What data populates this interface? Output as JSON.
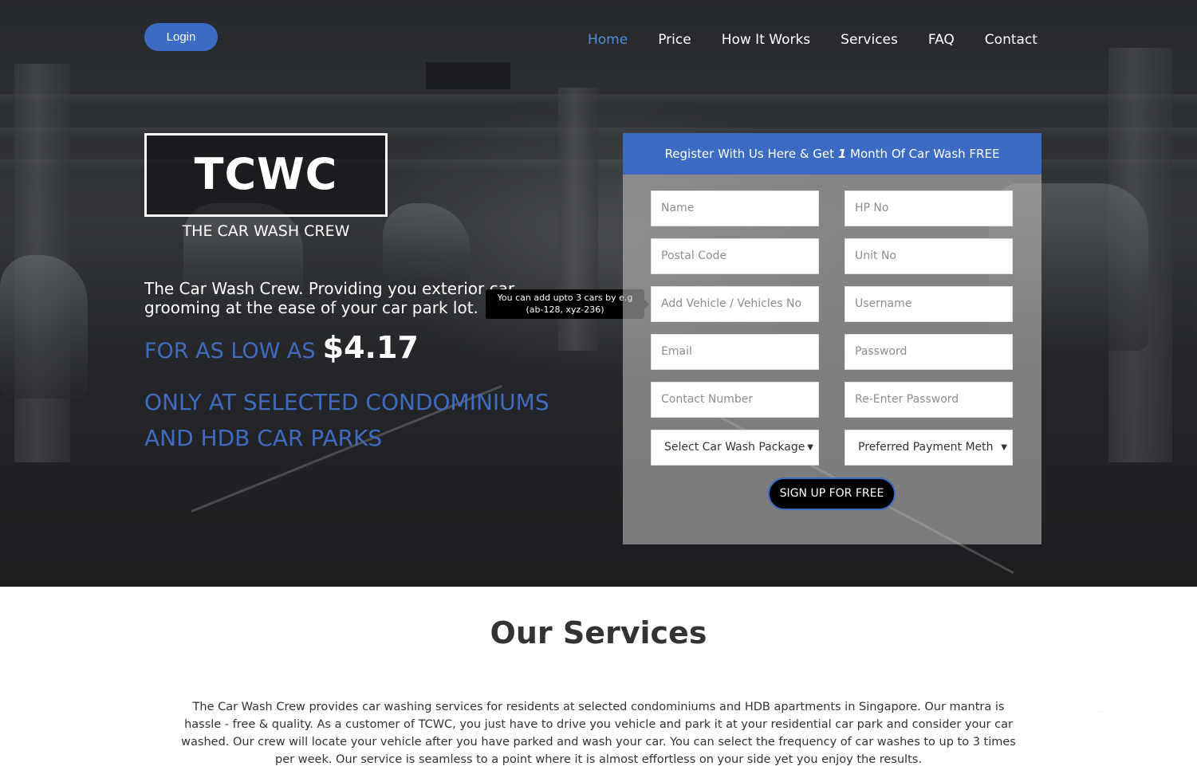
{
  "nav": {
    "login_label": "Login",
    "items": [
      "Home",
      "Price",
      "How It Works",
      "Services",
      "FAQ",
      "Contact"
    ],
    "active_item": "Home"
  },
  "hero": {
    "logo_text": "TCWC",
    "logo_subtitle": "THE CAR WASH CREW",
    "tagline": "The Car Wash Crew. Providing you exterior car grooming at the ease of your car park lot.",
    "price_prefix": "FOR AS LOW AS",
    "price_value": "$4.17",
    "condo_line_1": "ONLY AT SELECTED CONDOMINIUMS",
    "condo_line_2": "AND HDB CAR PARKS"
  },
  "tooltip": {
    "line1": "You can add upto 3 cars by e.g",
    "line2": "(ab-128, xyz-236)"
  },
  "form": {
    "header_before": "Register With Us Here & Get",
    "header_emphasis": "1",
    "header_after": "Month Of Car Wash FREE",
    "placeholders": {
      "name": "Name",
      "hp_no": "HP No",
      "postal_code": "Postal Code",
      "unit_no": "Unit No",
      "vehicle": "Add Vehicle / Vehicles No",
      "username": "Username",
      "email": "Email",
      "password": "Password",
      "contact_number": "Contact Number",
      "reenter_password": "Re-Enter Password"
    },
    "package_select": "Select Car Wash Package",
    "payment_select": "Preferred Payment Meth",
    "submit_label": "SIGN UP FOR FREE"
  },
  "services": {
    "title": "Our Services",
    "body": "The Car Wash Crew provides car washing services for residents at selected condominiums and HDB apartments in Singapore. Our mantra is hassle - free & quality. As a customer of TCWC, you just have to drive you vehicle and park it at your residential car park and consider your car washed. Our crew will locate your vehicle after you have parked and wash your car. You can select the frequency of car washes to up to 3 times per week. Our service is seamless to a point where it is almost effortless on your side yet you enjoy the results."
  },
  "colors": {
    "accent_blue": "#3c6bc4",
    "nav_active": "#4f8cd6",
    "text_dark": "#333333"
  }
}
